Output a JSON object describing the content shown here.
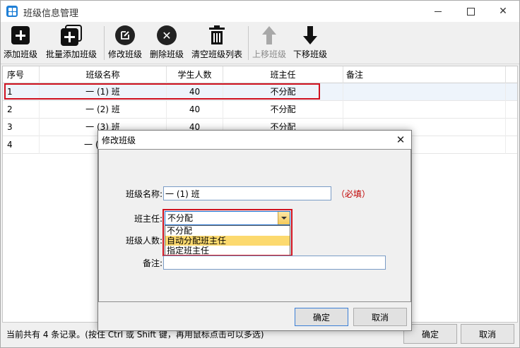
{
  "window": {
    "title": "班级信息管理"
  },
  "toolbar": {
    "add": "添加班级",
    "batch_add": "批量添加班级",
    "edit": "修改班级",
    "delete": "删除班级",
    "clear": "清空班级列表",
    "move_up": "上移班级",
    "move_down": "下移班级"
  },
  "grid": {
    "columns": [
      "序号",
      "班级名称",
      "学生人数",
      "班主任",
      "备注"
    ],
    "rows": [
      {
        "no": "1",
        "name": "一 (1) 班",
        "count": "40",
        "teacher": "不分配",
        "note": ""
      },
      {
        "no": "2",
        "name": "一 (2) 班",
        "count": "40",
        "teacher": "不分配",
        "note": ""
      },
      {
        "no": "3",
        "name": "一 (3) 班",
        "count": "40",
        "teacher": "不分配",
        "note": ""
      },
      {
        "no": "4",
        "name": "一 (",
        "count": "",
        "teacher": "",
        "note": ""
      }
    ]
  },
  "status": {
    "text": "当前共有 4 条记录。(按住 Ctrl 或 Shift 键，再用鼠标点击可以多选)"
  },
  "main_buttons": {
    "ok": "确定",
    "cancel": "取消"
  },
  "dialog": {
    "title": "修改班级",
    "name_label": "班级名称:",
    "name_value": "一 (1) 班",
    "required": "（必填）",
    "teacher_label": "班主任:",
    "teacher_value": "不分配",
    "options": [
      "不分配",
      "自动分配班主任",
      "指定班主任"
    ],
    "count_label": "班级人数:",
    "note_label": "备注:",
    "note_value": "",
    "ok": "确定",
    "cancel": "取消"
  }
}
